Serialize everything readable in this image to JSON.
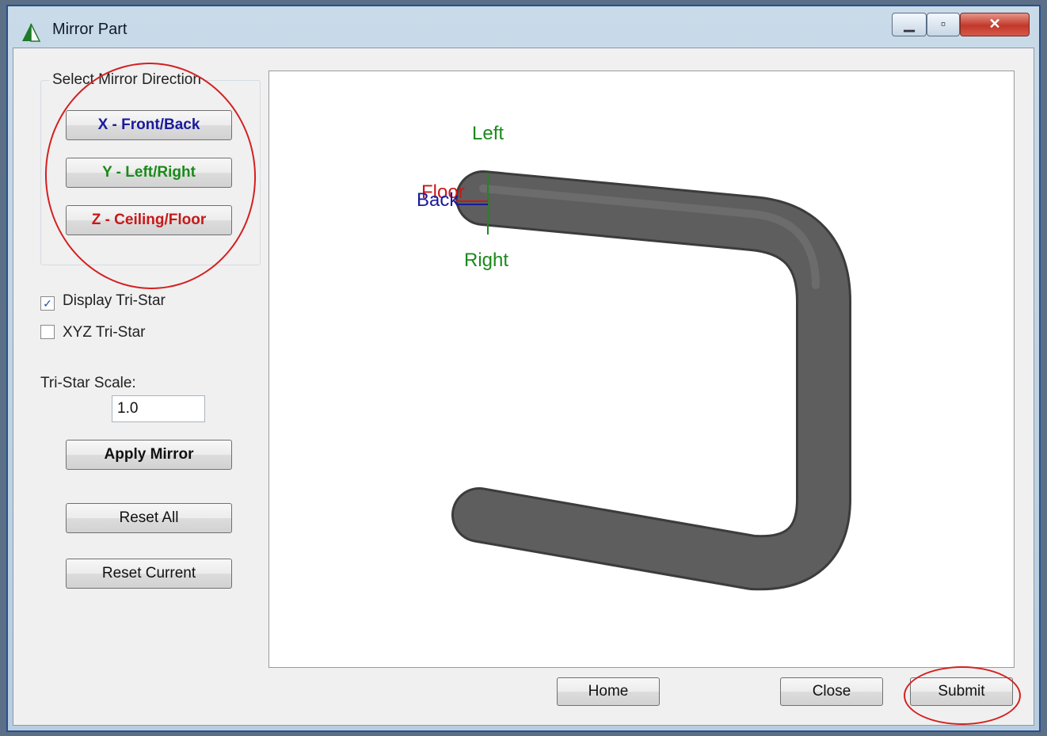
{
  "window": {
    "title": "Mirror Part"
  },
  "mirror_direction": {
    "group_label": "Select Mirror Direction",
    "x_label": "X - Front/Back",
    "y_label": "Y - Left/Right",
    "z_label": "Z - Ceiling/Floor",
    "colors": {
      "x": "#1a1a9c",
      "y": "#1a8a1a",
      "z": "#c81818"
    }
  },
  "options": {
    "display_tristar": {
      "label": "Display Tri-Star",
      "checked": true
    },
    "xyz_tristar": {
      "label": "XYZ Tri-Star",
      "checked": false
    }
  },
  "scale": {
    "label": "Tri-Star Scale:",
    "value": "1.0"
  },
  "actions": {
    "apply_label": "Apply Mirror",
    "reset_all_label": "Reset All",
    "reset_current_label": "Reset Current"
  },
  "viewport": {
    "label_left": "Left",
    "label_right": "Right",
    "label_floor": "Floor",
    "label_back": "Back",
    "tube_color": "#5e5e5e"
  },
  "footer": {
    "home_label": "Home",
    "close_label": "Close",
    "submit_label": "Submit"
  }
}
